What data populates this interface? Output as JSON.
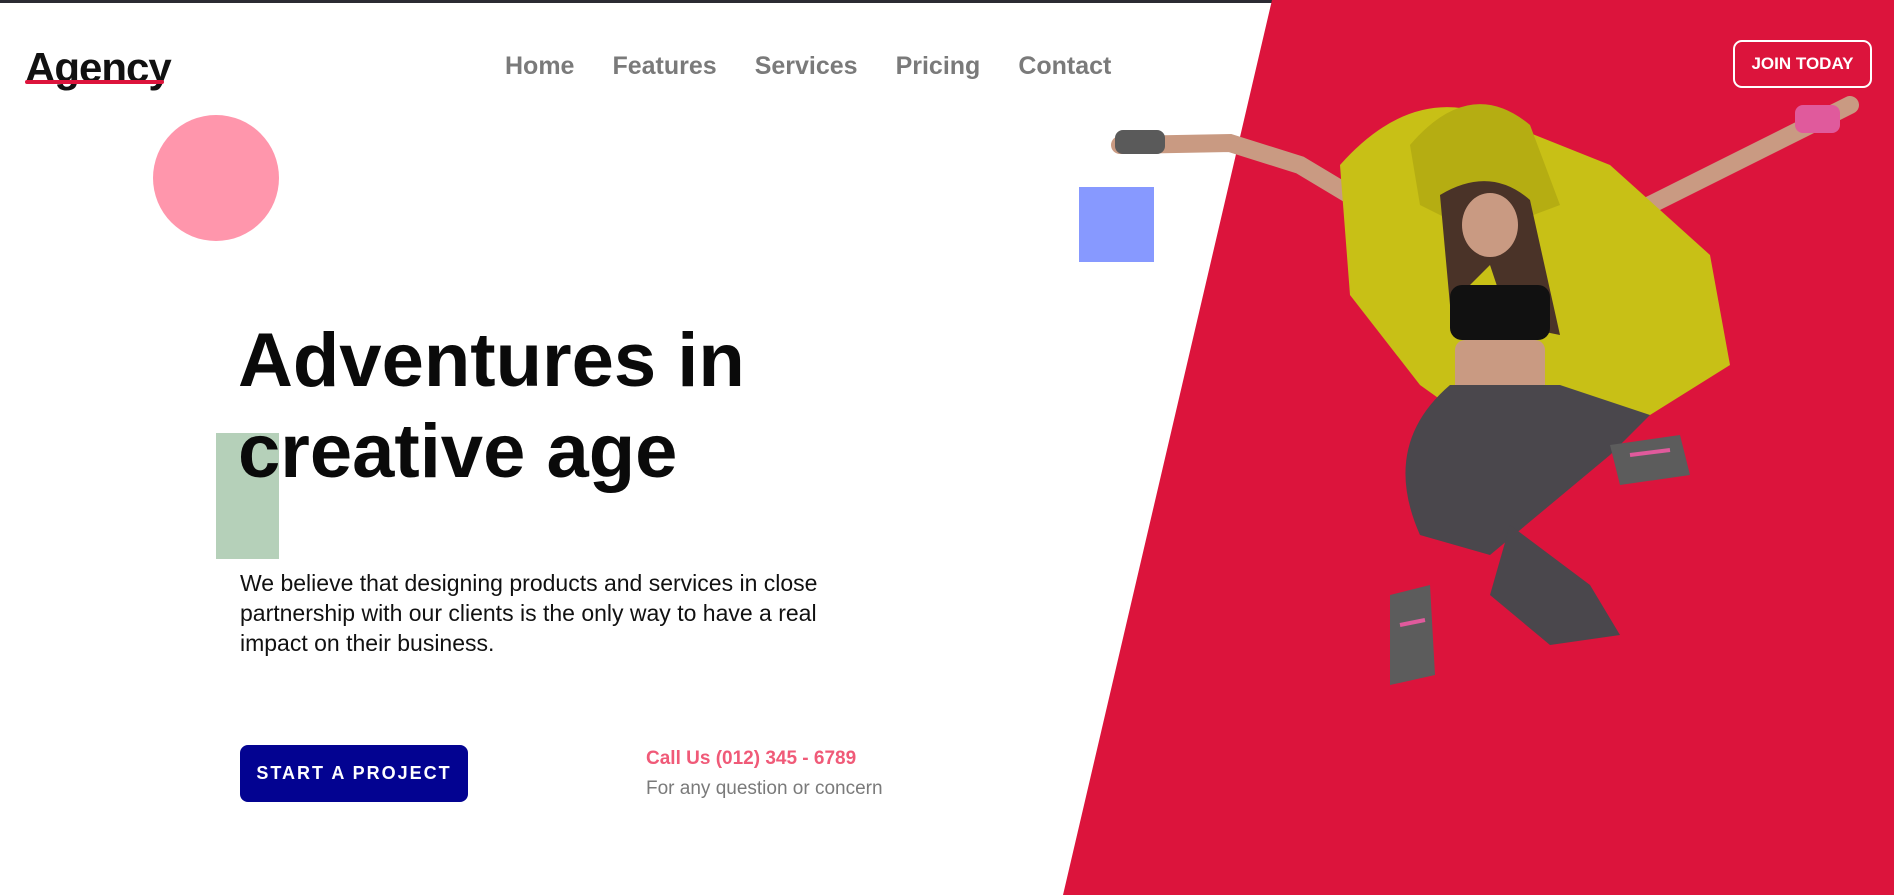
{
  "brand": {
    "logo_text": "Agency"
  },
  "nav": {
    "items": [
      {
        "label": "Home"
      },
      {
        "label": "Features"
      },
      {
        "label": "Services"
      },
      {
        "label": "Pricing"
      },
      {
        "label": "Contact"
      }
    ]
  },
  "header": {
    "join_label": "JOIN TODAY"
  },
  "hero": {
    "headline": "Adventures in creative age",
    "description": "We believe that designing products and services in close partnership with our clients is the only way to have a real impact on their business.",
    "cta_label": "START A PROJECT",
    "call_label": "Call Us (012) 345 - 6789",
    "call_sub": "For any question or concern"
  },
  "colors": {
    "accent_red": "#dc143c",
    "cta_navy": "#030391",
    "pink_circle": "#ff96ac",
    "blue_square": "#8799ff",
    "green_rect": "#b5d0b9",
    "nav_gray": "#7a7a7a"
  },
  "icons": {
    "hero_image": "jumping-dancer-image"
  }
}
